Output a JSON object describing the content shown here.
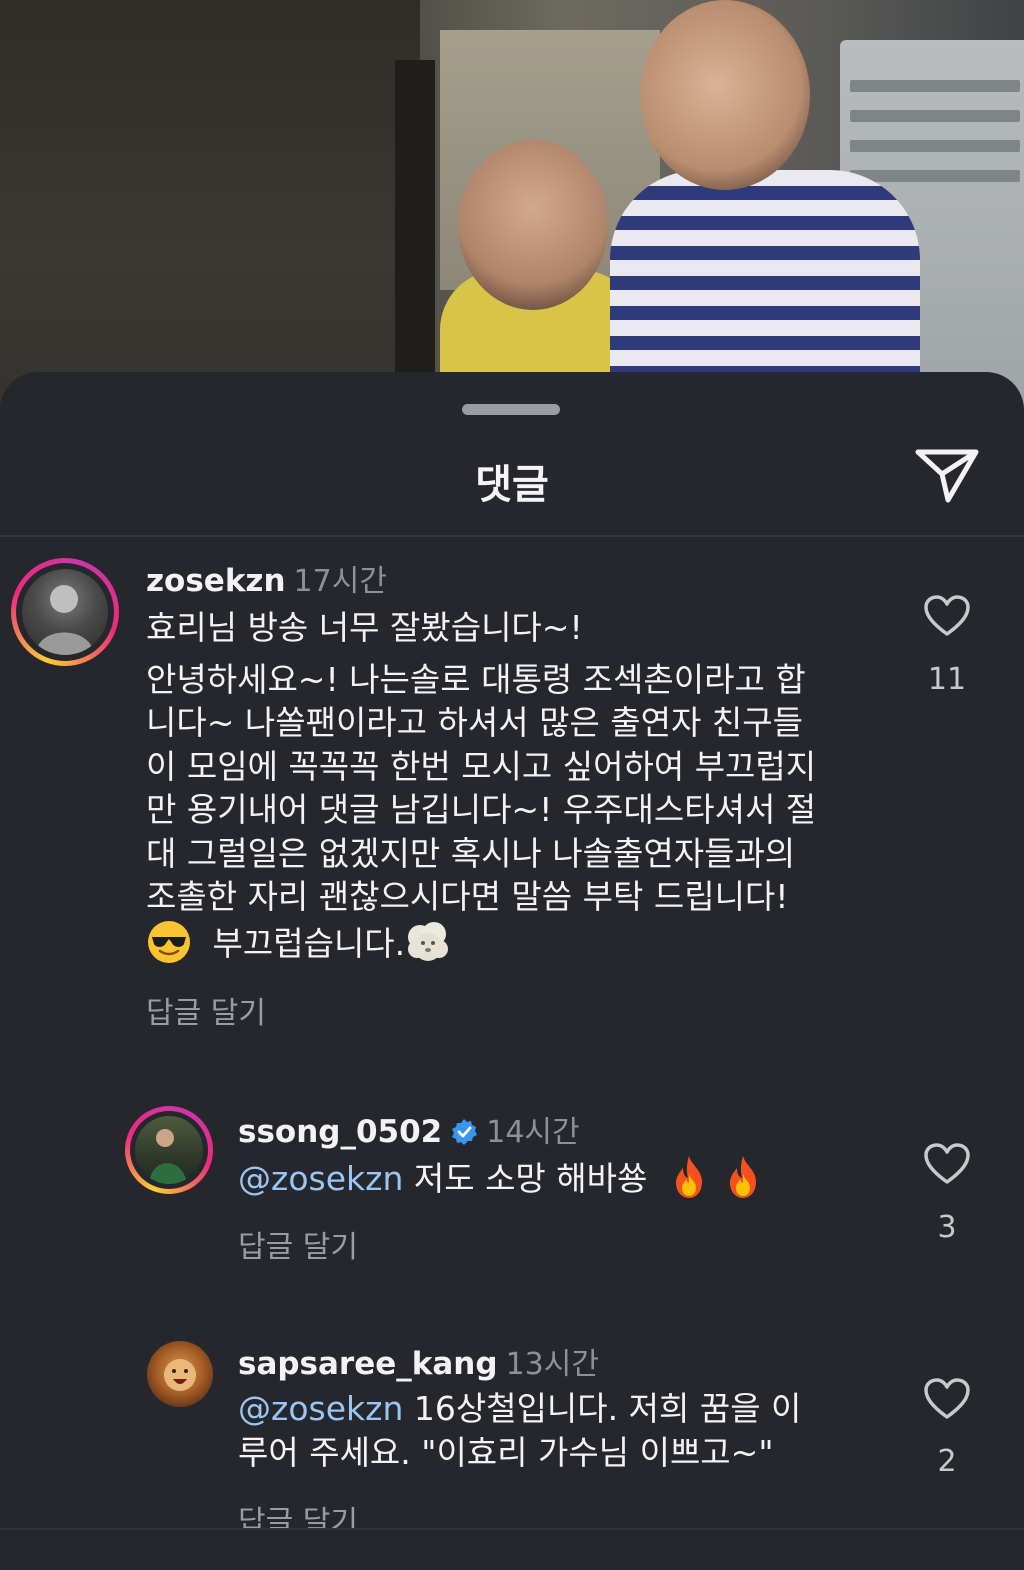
{
  "sheet": {
    "title": "댓글",
    "share_icon": "paper-plane-icon"
  },
  "comments": [
    {
      "username": "zosekzn",
      "time": "17시간",
      "line1": "효리님 방송 너무 잘봤습니다~!",
      "paragraph": [
        "안녕하세요~! 나는솔로 대통령 조섹촌이라고 합",
        "니다~ 나쏠팬이라고 하셔서 많은 출연자 친구들",
        "이 모임에 꼭꼭꼭 한번 모시고 싶어하여 부끄럽지",
        "만 용기내어 댓글 남깁니다~! 우주대스타셔서 절",
        "대 그럴일은 없겠지만 혹시나 나솔출연자들과의",
        "조촐한 자리 괜찮으시다면 말씀 부탁 드립니다!"
      ],
      "last_line_text": "부끄럽습니다.",
      "emojis": [
        "sunglasses-emoji",
        "cloud-face-emoji"
      ],
      "reply_label": "답글 달기",
      "likes": "11"
    },
    {
      "username": "ssong_0502",
      "verified": true,
      "time": "14시간",
      "mention": "@zosekzn",
      "text": "저도 소망 해바쑝",
      "emojis": [
        "fire-emoji",
        "fire-emoji"
      ],
      "reply_label": "답글 달기",
      "likes": "3"
    },
    {
      "username": "sapsaree_kang",
      "time": "13시간",
      "mention": "@zosekzn",
      "text_line1": "16상철입니다. 저희 꿈을 이",
      "text_line2": "루어 주세요. \"이효리 가수님 이쁘고~\"",
      "reply_label": "답글 달기",
      "likes": "2"
    }
  ],
  "colors": {
    "background": "#25272c",
    "mention": "#9ac6f4",
    "secondary_text": "#8e9096",
    "verified": "#3797f0"
  }
}
